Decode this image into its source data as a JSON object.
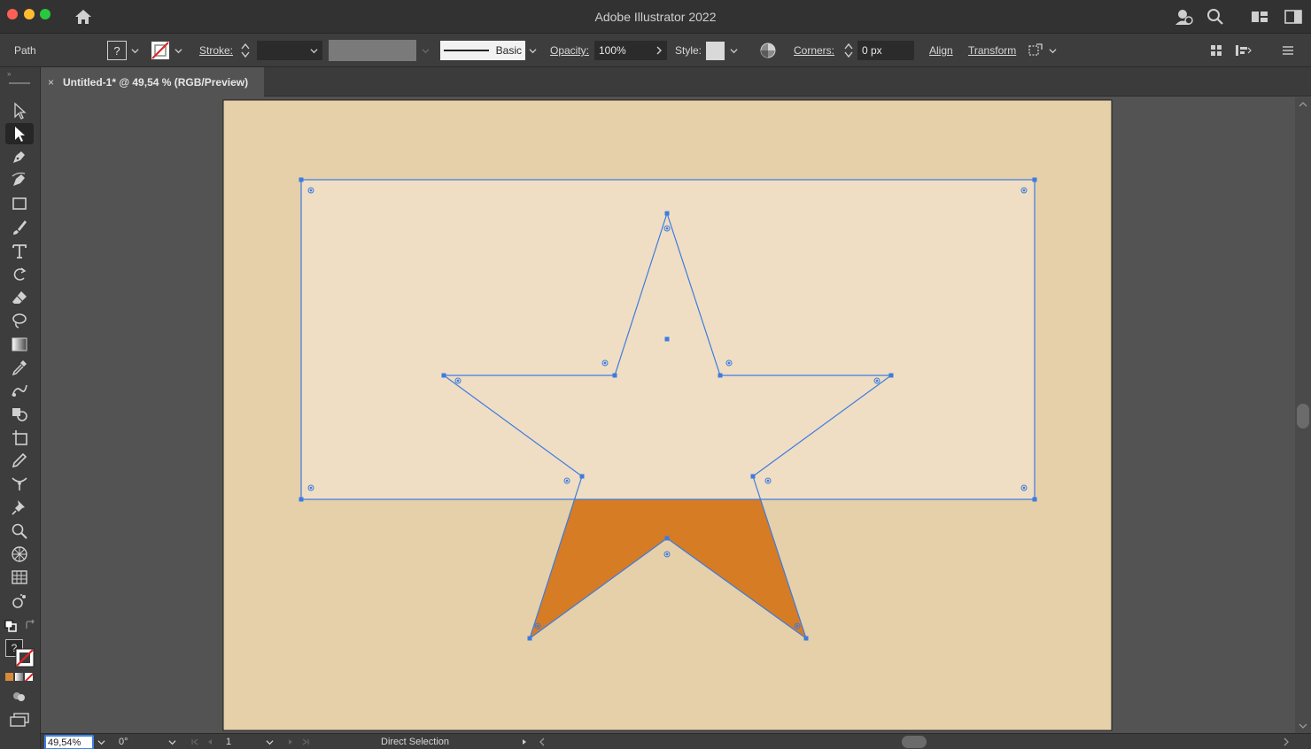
{
  "window": {
    "title": "Adobe Illustrator 2022"
  },
  "control_bar": {
    "selection_type": "Path",
    "fill_value": "?",
    "stroke_label": "Stroke:",
    "brush_label": "Basic",
    "opacity_label": "Opacity:",
    "opacity_value": "100%",
    "style_label": "Style:",
    "corners_label": "Corners:",
    "corners_value": "0 px",
    "align_label": "Align",
    "transform_label": "Transform"
  },
  "tabs": [
    {
      "label": "Untitled-1* @ 49,54 % (RGB/Preview)",
      "close": "×"
    }
  ],
  "toolbar": {
    "active_tool": "direct-selection",
    "fill_swatch_value": "?",
    "tools": [
      "selection-tool",
      "direct-selection-tool",
      "pen-tool",
      "curvature-tool",
      "rectangle-tool",
      "paintbrush-tool",
      "type-tool",
      "rotate-tool",
      "eraser-tool",
      "lasso-tool",
      "gradient-tool",
      "eyedropper-tool",
      "blend-tool",
      "shape-builder-tool",
      "artboard-tool",
      "pencil-tool",
      "width-tool",
      "puppet-warp-tool",
      "zoom-tool",
      "perspective-grid-tool",
      "mesh-tool",
      "symbol-sprayer-tool"
    ]
  },
  "artwork": {
    "artboard_color": "#e6d0aa",
    "rectangle_fill": "#efdec4",
    "star_fill": "#d67c25",
    "selection_color": "#3d7be0"
  },
  "status_bar": {
    "zoom": "49,54%",
    "rotation": "0°",
    "artboard_number": "1",
    "current_tool": "Direct Selection"
  }
}
